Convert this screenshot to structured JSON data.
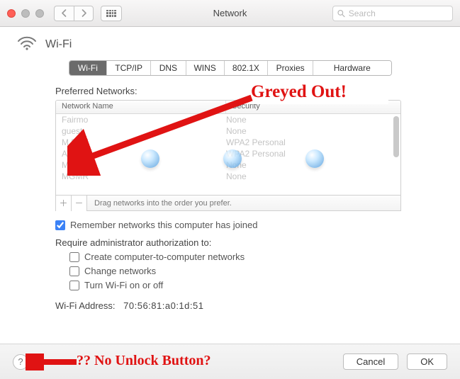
{
  "titlebar": {
    "title": "Network",
    "search_placeholder": "Search"
  },
  "header": {
    "title": "Wi-Fi"
  },
  "tabs": [
    "Wi-Fi",
    "TCP/IP",
    "DNS",
    "WINS",
    "802.1X",
    "Proxies",
    "Hardware"
  ],
  "preferred": {
    "label": "Preferred Networks:",
    "col_name": "Network Name",
    "col_security": "Security",
    "rows": [
      {
        "name": "Fairmo",
        "security": "None"
      },
      {
        "name": "guest-",
        "security": "None"
      },
      {
        "name": "M 5GH",
        "security": "WPA2 Personal"
      },
      {
        "name": "ATT-W",
        "security": "WPA2 Personal"
      },
      {
        "name": "McCar",
        "security": "None"
      },
      {
        "name": "MGMR",
        "security": "None"
      }
    ],
    "footer_hint": "Drag networks into the order you prefer."
  },
  "remember": {
    "label": "Remember networks this computer has joined",
    "checked": true
  },
  "require_label": "Require administrator authorization to:",
  "auth": {
    "c2c": "Create computer-to-computer networks",
    "change": "Change networks",
    "onoff": "Turn Wi-Fi on or off"
  },
  "address": {
    "label": "Wi-Fi Address:",
    "value": "70:56:81:a0:1d:51"
  },
  "buttons": {
    "cancel": "Cancel",
    "ok": "OK"
  },
  "annotations": {
    "a1": "Greyed Out!",
    "a2": "?? No Unlock Button?"
  }
}
